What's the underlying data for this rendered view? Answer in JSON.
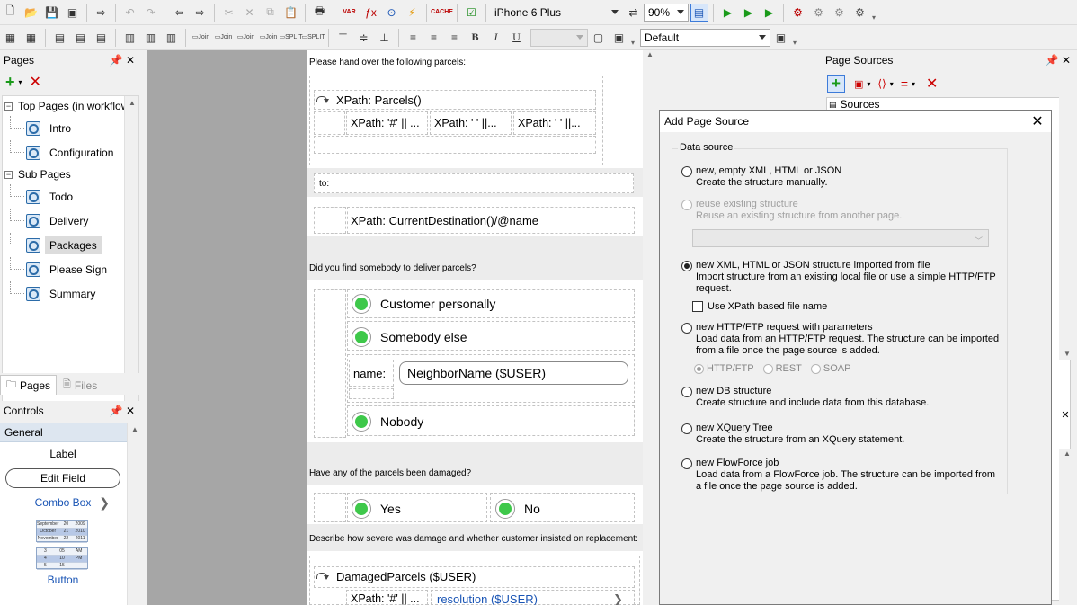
{
  "toolbar1": {
    "device": "iPhone 6 Plus",
    "zoom": "90%",
    "icon_var": "VAR",
    "icon_cache": "CACHE"
  },
  "toolbar2": {
    "join1": "Join",
    "join2": "Join",
    "join3": "Join",
    "join4": "Join",
    "split1": "SPLIT",
    "split2": "SPLIT",
    "bold": "B",
    "italic": "I",
    "underline": "U",
    "style_value": "Default"
  },
  "pages_panel": {
    "title": "Pages",
    "top_section": "Top Pages (in workflow",
    "top_items": [
      "Intro",
      "Configuration"
    ],
    "sub_section": "Sub Pages",
    "sub_items": [
      "Todo",
      "Delivery",
      "Packages",
      "Please Sign",
      "Summary"
    ],
    "tab_pages": "Pages",
    "tab_files": "Files"
  },
  "controls_panel": {
    "title": "Controls",
    "category": "General",
    "label": "Label",
    "edit_field": "Edit Field",
    "combo_box": "Combo Box",
    "button": "Button",
    "datepicker_rows": [
      [
        "September",
        "20",
        "2009"
      ],
      [
        "October",
        "21",
        "2010"
      ],
      [
        "November",
        "22",
        "2011"
      ]
    ],
    "timepicker_rows": [
      [
        "3",
        "05",
        "AM"
      ],
      [
        "4",
        "10",
        "PM"
      ],
      [
        "5",
        "15",
        ""
      ]
    ]
  },
  "design": {
    "hand_over": "Please hand over the following parcels:",
    "xpath_parcels": "XPath: Parcels()",
    "xpath_cell1": "XPath: '#' || ...",
    "xpath_cell2": "XPath: '   ' ||...",
    "xpath_cell3": "XPath: '   ' ||...",
    "to_label": "to:",
    "xpath_dest": "XPath: CurrentDestination()/@name",
    "question_found": "Did you find somebody to deliver parcels?",
    "opt_customer": "Customer personally",
    "opt_somebody": "Somebody else",
    "name_label": "name:",
    "name_value": "NeighborName ($USER)",
    "opt_nobody": "Nobody",
    "question_damaged": "Have any of the parcels been damaged?",
    "opt_yes": "Yes",
    "opt_no": "No",
    "describe": "Describe how severe was damage and whether customer insisted on replacement:",
    "damaged_parcels": "DamagedParcels ($USER)",
    "xpath_cell4": "XPath: '#' || ...",
    "resolution": "resolution ($USER)"
  },
  "page_sources": {
    "title": "Page Sources",
    "sources_label": "Sources"
  },
  "dialog": {
    "title": "Add Page Source",
    "group": "Data source",
    "opt1_title": "new, empty XML, HTML or JSON",
    "opt1_desc": "Create the structure manually.",
    "opt2_title": "reuse existing structure",
    "opt2_desc": "Reuse an existing structure from another page.",
    "opt3_title": "new XML, HTML or JSON structure imported from file",
    "opt3_desc1": "Import structure from an existing local file or use a simple  HTTP/FTP",
    "opt3_desc2": "request.",
    "checkbox_xpath": "Use XPath based file name",
    "opt4_title": "new HTTP/FTP request with parameters",
    "opt4_desc1": "Load data from an HTTP/FTP request. The structure can be imported",
    "opt4_desc2": "from a file once the page source is added.",
    "proto_http": "HTTP/FTP",
    "proto_rest": "REST",
    "proto_soap": "SOAP",
    "opt5_title": "new DB structure",
    "opt5_desc": "Create structure and include data from this database.",
    "opt6_title": "new XQuery Tree",
    "opt6_desc": "Create the structure from an XQuery statement.",
    "opt7_title": "new FlowForce job",
    "opt7_desc1": "Load data from a FlowForce job. The structure can be imported from",
    "opt7_desc2": "a file once the page source is added."
  },
  "colors": {
    "accent_green": "#3ec84a",
    "link_blue": "#1a55b5",
    "design_bg": "#a6a6a6"
  }
}
